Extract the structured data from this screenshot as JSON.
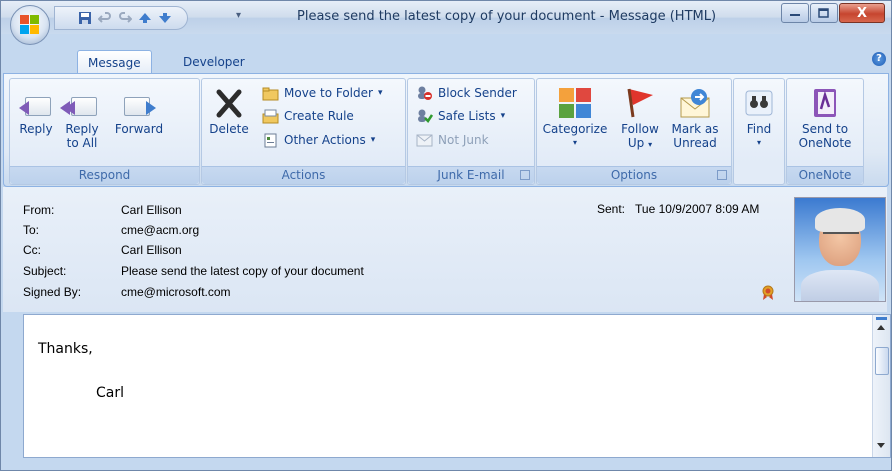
{
  "window": {
    "title": "Please send the latest copy of your document  - Message (HTML)",
    "minimize_glyph": "—",
    "maximize_glyph": "☐",
    "close_glyph": "X"
  },
  "quick_access": {
    "icons": [
      "save-icon",
      "undo-icon",
      "redo-icon",
      "previous-item-icon",
      "next-item-icon",
      "customize-dropdown-icon"
    ]
  },
  "tabs": [
    {
      "label": "Message",
      "active": true
    },
    {
      "label": "Developer",
      "active": false
    }
  ],
  "help_glyph": "?",
  "ribbon": {
    "respond": {
      "group_label": "Respond",
      "reply": "Reply",
      "reply_all_line1": "Reply",
      "reply_all_line2": "to All",
      "forward": "Forward"
    },
    "actions": {
      "group_label": "Actions",
      "delete": "Delete",
      "move_to_folder": "Move to Folder",
      "create_rule": "Create Rule",
      "other_actions": "Other Actions"
    },
    "junk": {
      "group_label": "Junk E-mail",
      "block_sender": "Block Sender",
      "safe_lists": "Safe Lists",
      "not_junk": "Not Junk"
    },
    "options": {
      "group_label": "Options",
      "categorize": "Categorize",
      "follow_up_line1": "Follow",
      "follow_up_line2": "Up",
      "mark_unread_line1": "Mark as",
      "mark_unread_line2": "Unread"
    },
    "find": {
      "label": "Find"
    },
    "onenote": {
      "group_label": "OneNote",
      "send_line1": "Send to",
      "send_line2": "OneNote"
    },
    "dropdown_glyph": "▾"
  },
  "header": {
    "from_label": "From:",
    "from_value": "Carl Ellison",
    "to_label": "To:",
    "to_value": "cme@acm.org",
    "cc_label": "Cc:",
    "cc_value": "Carl Ellison",
    "subject_label": "Subject:",
    "subject_value": "Please send the latest copy of your document",
    "signed_label": "Signed By:",
    "signed_value": "cme@microsoft.com",
    "sent_label": "Sent:",
    "sent_value": "Tue 10/9/2007 8:09 AM"
  },
  "body": {
    "line1": "Thanks,",
    "line2": "Carl"
  },
  "colors": {
    "ribbon_text": "#15428b",
    "group_label": "#3e6aaa",
    "frame": "#c4d8ef",
    "close_red": "#c6452f"
  }
}
